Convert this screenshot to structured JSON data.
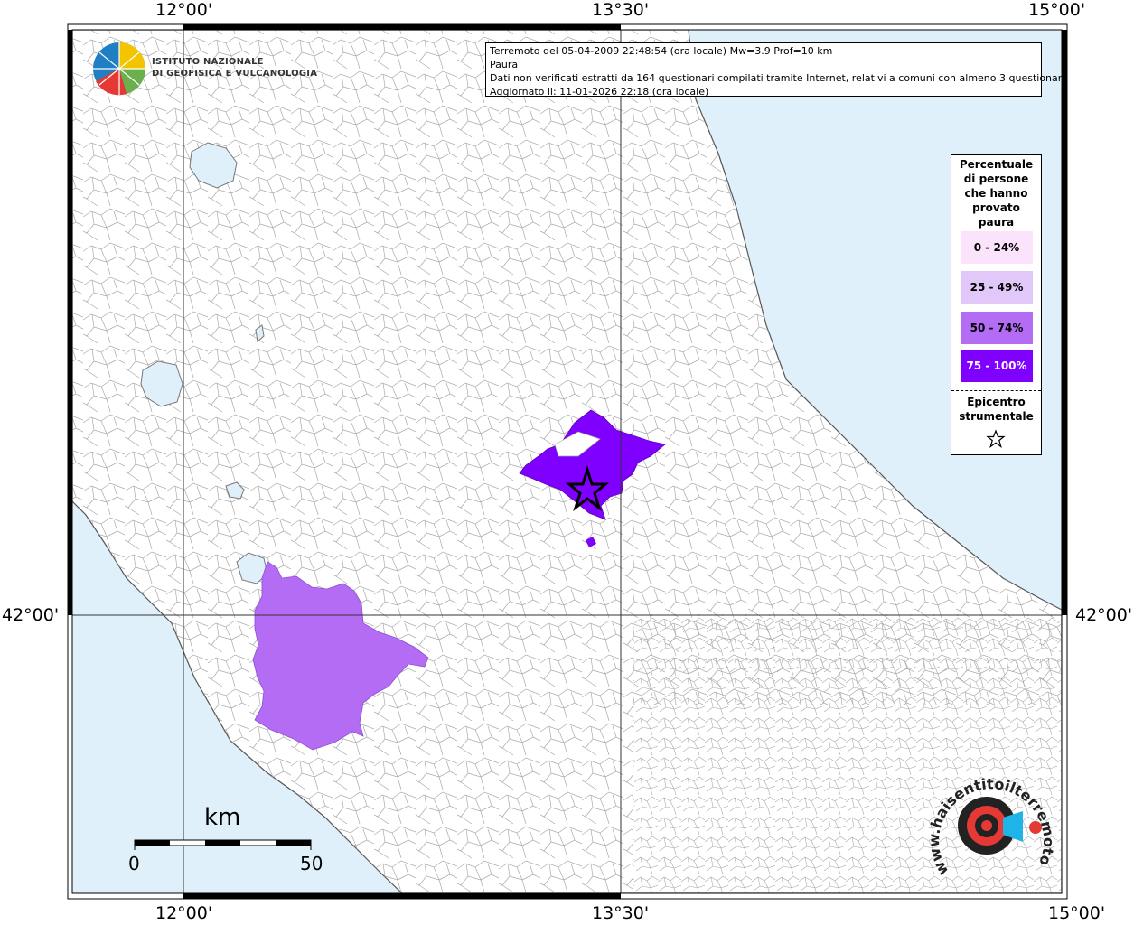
{
  "coordinates": {
    "top": [
      "12°00'",
      "13°30'",
      "15°00'"
    ],
    "bottom": [
      "12°00'",
      "13°30'",
      "15°00'"
    ],
    "left": "42°00'",
    "right": "42°00'"
  },
  "logo": {
    "line1": "ISTITUTO NAZIONALE",
    "line2": "DI GEOFISICA E VULCANOLOGIA"
  },
  "info": {
    "line1": "Terremoto del 05-04-2009 22:48:54 (ora locale) Mw=3.9 Prof=10 km",
    "line2": "Paura",
    "line3": "Dati non verificati estratti da 164 questionari compilati tramite Internet, relativi a comuni con almeno 3 questionari.",
    "line4": "Aggiornato il: 11-01-2026 22:18 (ora locale)"
  },
  "legend": {
    "title_lines": [
      "Percentuale",
      "di persone",
      "che hanno",
      "provato",
      "paura"
    ],
    "classes": [
      {
        "label": "0 - 24%",
        "color": "#fbe3fb",
        "text_color": "#000000"
      },
      {
        "label": "25 - 49%",
        "color": "#e2c8f8",
        "text_color": "#000000"
      },
      {
        "label": "50 - 74%",
        "color": "#b46cf4",
        "text_color": "#000000"
      },
      {
        "label": "75 - 100%",
        "color": "#8000ff",
        "text_color": "#ffffff"
      }
    ],
    "epicenter_lines": [
      "Epicentro",
      "strumentale"
    ]
  },
  "scale": {
    "unit": "km",
    "min": "0",
    "max": "50"
  },
  "watermark": {
    "text": "www.haisentitoilterremoto.it"
  },
  "colors": {
    "sea": "#dff0fb",
    "land": "#ffffff",
    "border": "#9a9a9a"
  }
}
